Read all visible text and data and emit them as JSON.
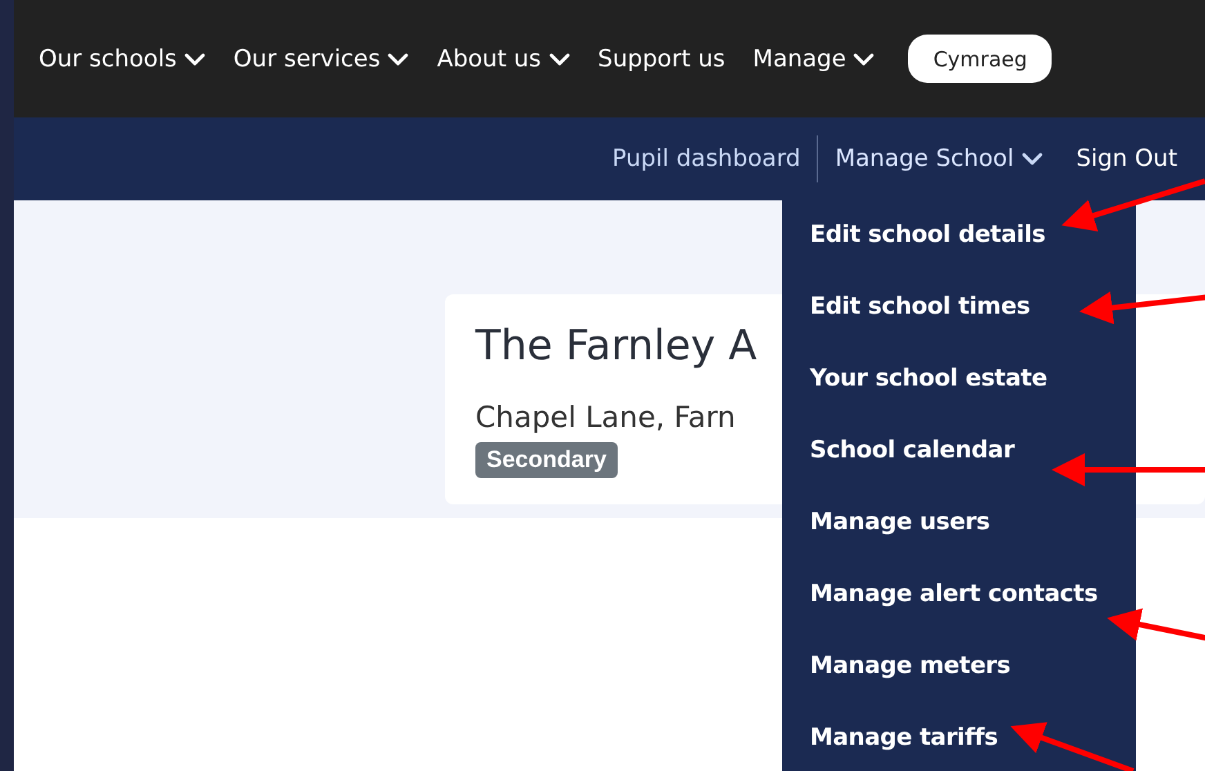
{
  "top_nav": {
    "items": [
      {
        "label": "Our schools",
        "dropdown": true
      },
      {
        "label": "Our services",
        "dropdown": true
      },
      {
        "label": "About us",
        "dropdown": true
      },
      {
        "label": "Support us",
        "dropdown": false
      },
      {
        "label": "Manage",
        "dropdown": true
      }
    ],
    "language_button": "Cymraeg"
  },
  "sub_nav": {
    "items": [
      {
        "label": "Pupil dashboard",
        "dropdown": false,
        "expanded": false
      },
      {
        "label": "Manage School",
        "dropdown": true,
        "expanded": true
      },
      {
        "label": "Sign Out",
        "dropdown": false,
        "expanded": false
      }
    ]
  },
  "school_card": {
    "name": "The Farnley A",
    "address": "Chapel Lane, Farn",
    "badge": "Secondary"
  },
  "manage_menu": {
    "items": [
      "Edit school details",
      "Edit school times",
      "Your school estate",
      "School calendar",
      "Manage users",
      "Manage alert contacts",
      "Manage meters",
      "Manage tariffs"
    ]
  }
}
